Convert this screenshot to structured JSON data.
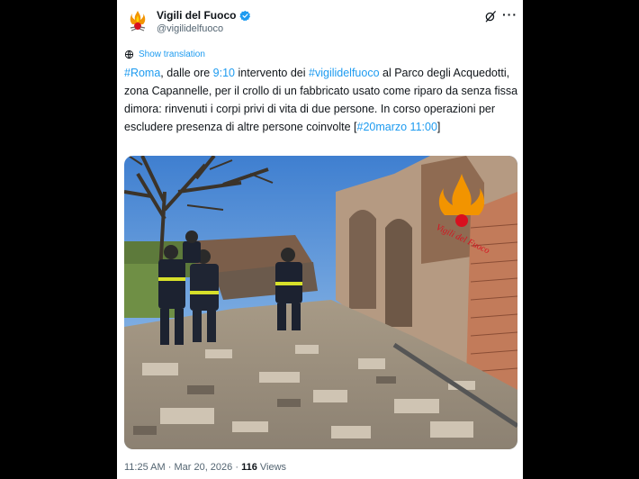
{
  "account": {
    "display_name": "Vigili del Fuoco",
    "handle": "@vigilidelfuoco"
  },
  "translation": {
    "label": "Show translation"
  },
  "tweet": {
    "segments": [
      {
        "text": "#Roma",
        "link": true
      },
      {
        "text": ", dalle ore ",
        "link": false
      },
      {
        "text": "9:10",
        "link": true
      },
      {
        "text": " intervento dei ",
        "link": false
      },
      {
        "text": "#vigilidelfuoco",
        "link": true
      },
      {
        "text": " al Parco degli Acquedotti, zona Capannelle, per il crollo di un fabbricato usato come riparo da senza fissa dimora: rinvenuti i corpi privi di vita di due persone. In corso operazioni per escludere presenza di altre persone coinvolte ",
        "link": false
      },
      {
        "text": "[",
        "link": false
      },
      {
        "text": "#20marzo 11:00",
        "link": true
      },
      {
        "text": "]",
        "link": false
      }
    ]
  },
  "photo": {
    "watermark": "Vigili del Fuoco"
  },
  "meta": {
    "time": "11:25 AM",
    "separator": " · ",
    "date": "Mar 20, 2026",
    "views_count": "116",
    "views_label": " Views"
  },
  "colors": {
    "link": "#1d9bf0",
    "verified": "#1d9bf0",
    "text": "#0f1419",
    "secondary": "#536471"
  }
}
